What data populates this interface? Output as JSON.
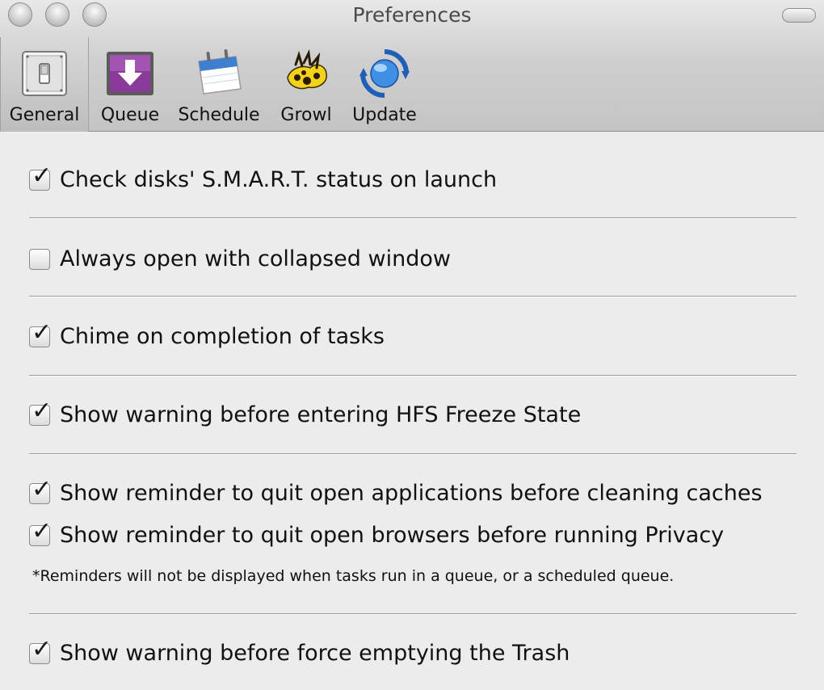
{
  "window": {
    "title": "Preferences"
  },
  "toolbar": {
    "items": [
      {
        "label": "General",
        "icon": "toggle-switch-icon",
        "selected": true
      },
      {
        "label": "Queue",
        "icon": "download-arrow-icon",
        "selected": false
      },
      {
        "label": "Schedule",
        "icon": "calendar-icon",
        "selected": false
      },
      {
        "label": "Growl",
        "icon": "growl-paw-icon",
        "selected": false
      },
      {
        "label": "Update",
        "icon": "sync-globe-icon",
        "selected": false
      }
    ]
  },
  "options": [
    {
      "label": "Check disks' S.M.A.R.T. status on launch",
      "checked": true
    },
    {
      "label": "Always open with collapsed window",
      "checked": false
    },
    {
      "label": "Chime on completion of tasks",
      "checked": true
    },
    {
      "label": "Show warning before entering HFS Freeze State",
      "checked": true
    },
    {
      "label": "Show reminder to quit open applications before cleaning caches",
      "checked": true
    },
    {
      "label": "Show reminder to quit open browsers before running Privacy",
      "checked": true
    },
    {
      "label": "Show warning before force emptying the Trash",
      "checked": true
    }
  ],
  "note": "*Reminders will not be displayed when tasks run in a queue, or a scheduled queue.",
  "colors": {
    "window_bg": "#ececec",
    "queue_purple": "#8a3a9a",
    "update_blue": "#1f5fb8",
    "growl_yellow": "#f2d21a"
  }
}
